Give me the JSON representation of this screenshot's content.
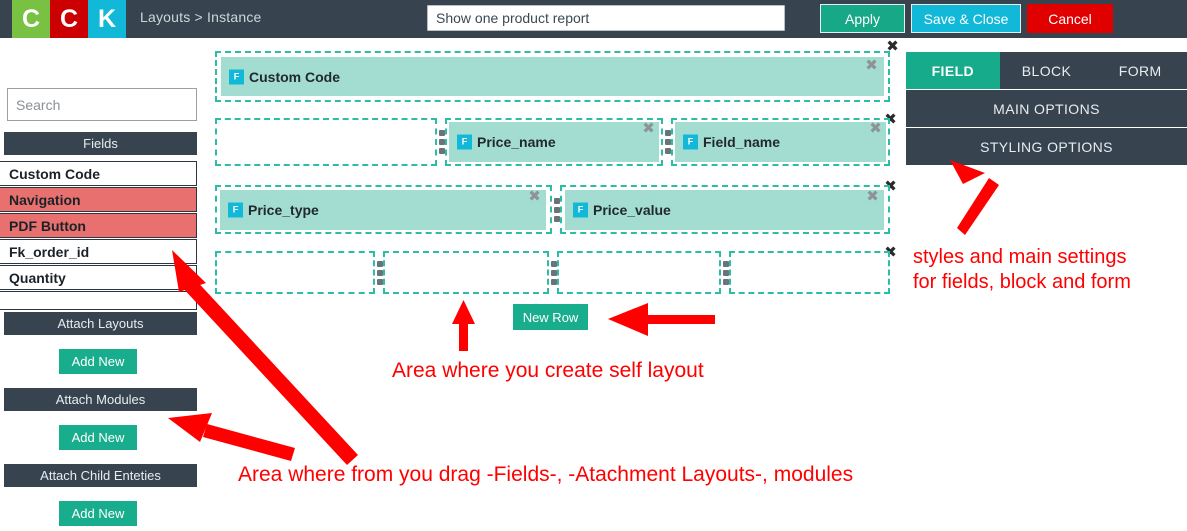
{
  "header": {
    "logo_letters": [
      "C",
      "C",
      "K"
    ],
    "breadcrumb": "Layouts > Instance",
    "title_value": "Show one product report",
    "title_placeholder": "Title",
    "buttons": {
      "apply": "Apply",
      "save_close": "Save & Close",
      "cancel": "Cancel"
    },
    "colors": {
      "logo_green": "#79c143",
      "logo_red": "#cc0000",
      "logo_cyan": "#11b8d8",
      "bar_bg": "#37444f",
      "apply": "#16a887",
      "save": "#11b8d8",
      "cancel": "#e00000"
    }
  },
  "sidebar": {
    "search_placeholder": "Search",
    "search_value": "",
    "fields_header": "Fields",
    "fields": [
      {
        "label": "Custom Code",
        "highlighted": false
      },
      {
        "label": "Navigation",
        "highlighted": true
      },
      {
        "label": "PDF Button",
        "highlighted": true
      },
      {
        "label": "Fk_order_id",
        "highlighted": false
      },
      {
        "label": "Quantity",
        "highlighted": false
      }
    ],
    "sections": [
      {
        "header": "Attach Layouts",
        "button": "Add New"
      },
      {
        "header": "Attach Modules",
        "button": "Add New"
      },
      {
        "header": "Attach Child Enteties",
        "button": "Add New"
      }
    ],
    "highlight_color": "#e8706e"
  },
  "canvas": {
    "new_row_label": "New Row",
    "field_badge": "F",
    "close_glyph": "✖",
    "rows": [
      {
        "columns": [
          {
            "field": "Custom Code",
            "empty": false
          }
        ]
      },
      {
        "columns": [
          {
            "field": "",
            "empty": true
          },
          {
            "field": "Price_name",
            "empty": false
          },
          {
            "field": "Field_name",
            "empty": false
          }
        ]
      },
      {
        "columns": [
          {
            "field": "Price_type",
            "empty": false
          },
          {
            "field": "Price_value",
            "empty": false
          }
        ]
      },
      {
        "columns": [
          {
            "field": "",
            "empty": true
          },
          {
            "field": "",
            "empty": true
          },
          {
            "field": "",
            "empty": true
          },
          {
            "field": "",
            "empty": true
          }
        ]
      }
    ],
    "colors": {
      "row_border": "#2bbda6",
      "block_bg": "#a3ddd1",
      "badge_bg": "#11b8d8"
    }
  },
  "right_panel": {
    "tabs": [
      {
        "label": "FIELD",
        "active": true
      },
      {
        "label": "BLOCK",
        "active": false
      },
      {
        "label": "FORM",
        "active": false
      }
    ],
    "bars": [
      "MAIN OPTIONS",
      "STYLING OPTIONS"
    ],
    "active_color": "#16ab8b"
  },
  "annotations": {
    "right": "styles and main settings\nfor fields, block and form",
    "middle": "Area where you create self layout",
    "bottom": "Area where from you drag -Fields-, -Atachment Layouts-, modules",
    "color": "#ff0000"
  }
}
